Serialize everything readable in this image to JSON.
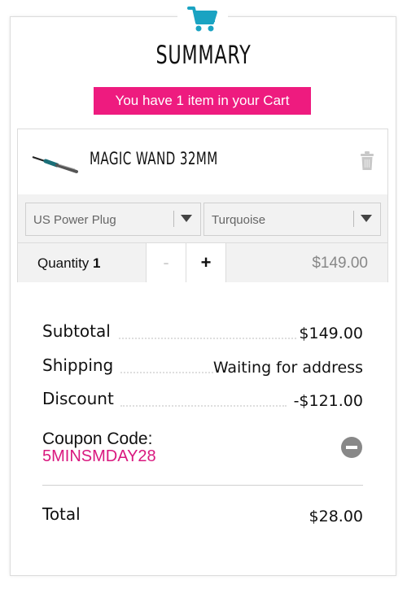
{
  "header": {
    "icon": "shopping-cart-icon",
    "title": "SUMMARY",
    "cart_message": "You have 1 item in your Cart"
  },
  "item": {
    "thumbnail": "curling-wand-image",
    "name": "MAGIC WAND 32MM",
    "remove_icon": "trash-icon",
    "plug_option": "US Power Plug",
    "color_option": "Turquoise",
    "quantity_label": "Quantity",
    "quantity": "1",
    "decrement_label": "-",
    "increment_label": "+",
    "price": "$149.00"
  },
  "totals": {
    "subtotal_label": "Subtotal",
    "subtotal_value": "$149.00",
    "shipping_label": "Shipping",
    "shipping_value": "Waiting for address",
    "discount_label": "Discount",
    "discount_value": "-$121.00",
    "coupon_label": "Coupon Code:",
    "coupon_code": "5MINSMDAY28",
    "total_label": "Total",
    "total_value": "$28.00"
  },
  "colors": {
    "accent_pink": "#ee1b7f",
    "coupon_pink": "#d9187f",
    "cart_icon": "#1aa3c2"
  }
}
